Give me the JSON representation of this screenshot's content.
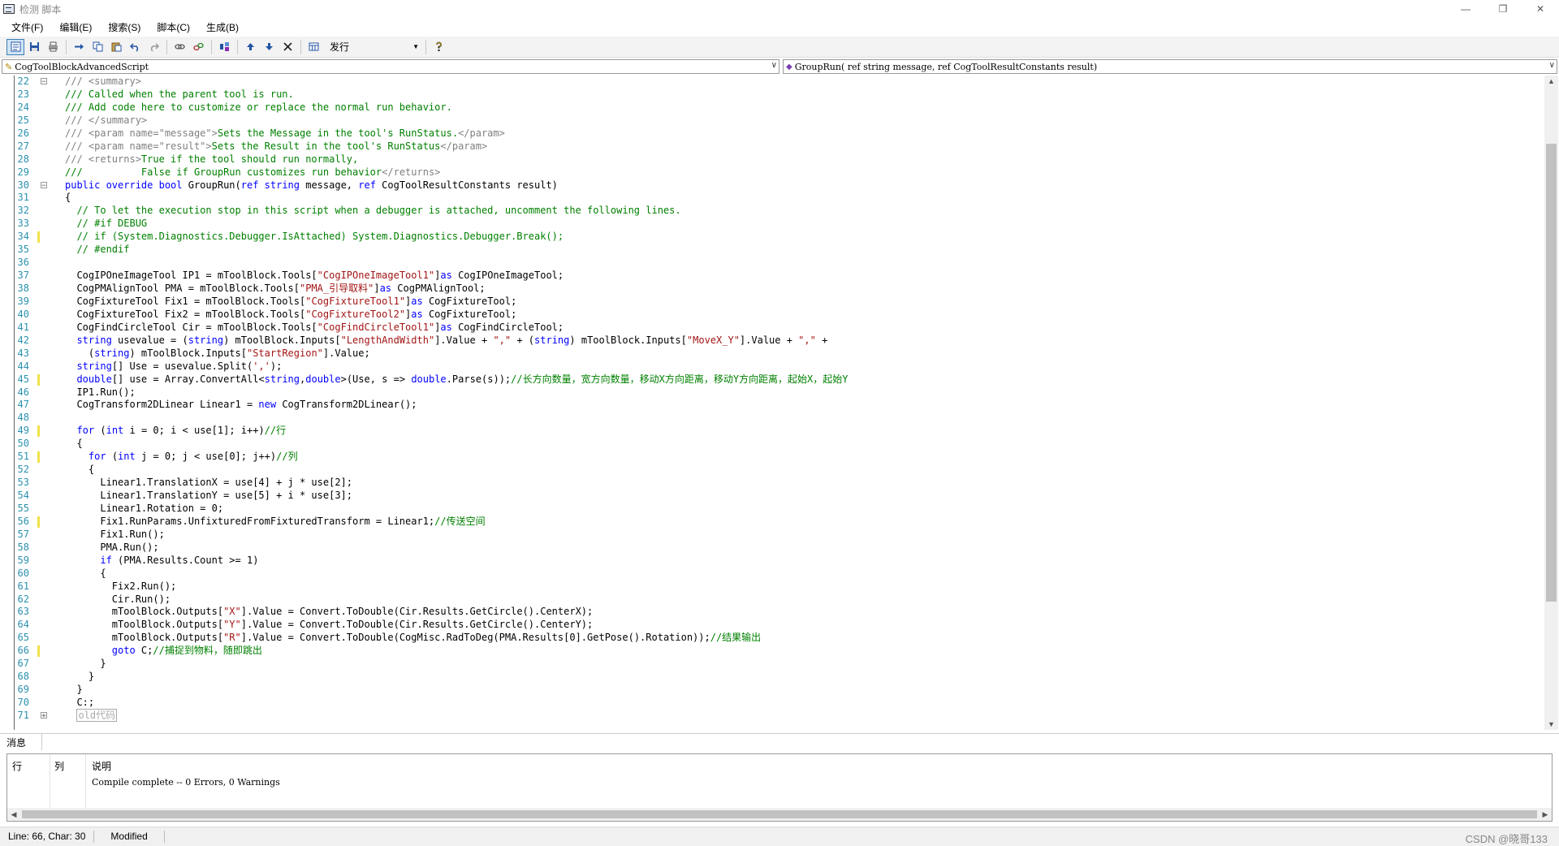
{
  "window": {
    "title": "检测 脚本",
    "minimize": "—",
    "restore": "❐",
    "close": "✕"
  },
  "menu": [
    "文件(F)",
    "编辑(E)",
    "搜索(S)",
    "脚本(C)",
    "生成(B)"
  ],
  "toolbar": {
    "build_select": "发行",
    "icons": [
      "script-view-icon",
      "save-icon",
      "print-icon",
      "indent-icon",
      "copy-icon",
      "paste-icon",
      "undo-icon",
      "redo-icon",
      "link-icon",
      "unlink-icon",
      "compile-icon",
      "up-arrow-icon",
      "down-arrow-icon",
      "delete-icon",
      "calculator-icon",
      "help-icon"
    ]
  },
  "combos": {
    "class": "CogToolBlockAdvancedScript",
    "method": "GroupRun( ref string message,  ref CogToolResultConstants result)"
  },
  "editor": {
    "lines": [
      {
        "n": "22",
        "fold": "minus",
        "mark": false,
        "html": "<span class=\"xm\">/// &lt;summary&gt;</span>"
      },
      {
        "n": "23",
        "mark": false,
        "html": "<span class=\"cm\">/// Called when the parent tool is run.</span>"
      },
      {
        "n": "24",
        "mark": false,
        "html": "<span class=\"cm\">/// Add code here to customize or replace the normal run behavior.</span>"
      },
      {
        "n": "25",
        "mark": false,
        "html": "<span class=\"xm\">/// &lt;/summary&gt;</span>"
      },
      {
        "n": "26",
        "mark": false,
        "html": "<span class=\"xm\">/// &lt;param name=\"message\"&gt;</span><span class=\"cm\">Sets the Message in the tool's RunStatus.</span><span class=\"xm\">&lt;/param&gt;</span>"
      },
      {
        "n": "27",
        "mark": false,
        "html": "<span class=\"xm\">/// &lt;param name=\"result\"&gt;</span><span class=\"cm\">Sets the Result in the tool's RunStatus</span><span class=\"xm\">&lt;/param&gt;</span>"
      },
      {
        "n": "28",
        "mark": false,
        "html": "<span class=\"xm\">/// &lt;returns&gt;</span><span class=\"cm\">True if the tool should run normally,</span>"
      },
      {
        "n": "29",
        "mark": false,
        "html": "<span class=\"cm\">///          False if GroupRun customizes run behavior</span><span class=\"xm\">&lt;/returns&gt;</span>"
      },
      {
        "n": "30",
        "fold": "minus",
        "mark": false,
        "html": "<span class=\"kw\">public override bool</span> GroupRun(<span class=\"kw\">ref string</span> message, <span class=\"kw\">ref</span> CogToolResultConstants result)"
      },
      {
        "n": "31",
        "mark": false,
        "html": "{"
      },
      {
        "n": "32",
        "mark": false,
        "html": "  <span class=\"cm\">// To let the execution stop in this script when a debugger is attached, uncomment the following lines.</span>"
      },
      {
        "n": "33",
        "mark": false,
        "html": "  <span class=\"cm\">// #if DEBUG</span>"
      },
      {
        "n": "34",
        "mark": true,
        "html": "  <span class=\"cm\">// if (System.Diagnostics.Debugger.IsAttached) System.Diagnostics.Debugger.Break();</span>"
      },
      {
        "n": "35",
        "mark": false,
        "html": "  <span class=\"cm\">// #endif</span>"
      },
      {
        "n": "36",
        "mark": false,
        "html": ""
      },
      {
        "n": "37",
        "mark": false,
        "html": "  CogIPOneImageTool IP1 = mToolBlock.Tools[<span class=\"str\">\"CogIPOneImageTool1\"</span>]<span class=\"kw\">as</span> CogIPOneImageTool;"
      },
      {
        "n": "38",
        "mark": false,
        "html": "  CogPMAlignTool PMA = mToolBlock.Tools[<span class=\"str\">\"PMA_引导取料\"</span>]<span class=\"kw\">as</span> CogPMAlignTool;"
      },
      {
        "n": "39",
        "mark": false,
        "html": "  CogFixtureTool Fix1 = mToolBlock.Tools[<span class=\"str\">\"CogFixtureTool1\"</span>]<span class=\"kw\">as</span> CogFixtureTool;"
      },
      {
        "n": "40",
        "mark": false,
        "html": "  CogFixtureTool Fix2 = mToolBlock.Tools[<span class=\"str\">\"CogFixtureTool2\"</span>]<span class=\"kw\">as</span> CogFixtureTool;"
      },
      {
        "n": "41",
        "mark": false,
        "html": "  CogFindCircleTool Cir = mToolBlock.Tools[<span class=\"str\">\"CogFindCircleTool1\"</span>]<span class=\"kw\">as</span> CogFindCircleTool;"
      },
      {
        "n": "42",
        "mark": false,
        "html": "  <span class=\"kw\">string</span> usevalue = (<span class=\"kw\">string</span>) mToolBlock.Inputs[<span class=\"str\">\"LengthAndWidth\"</span>].Value + <span class=\"str\">\",\"</span> + (<span class=\"kw\">string</span>) mToolBlock.Inputs[<span class=\"str\">\"MoveX_Y\"</span>].Value + <span class=\"str\">\",\"</span> +"
      },
      {
        "n": "43",
        "mark": false,
        "html": "    (<span class=\"kw\">string</span>) mToolBlock.Inputs[<span class=\"str\">\"StartRegion\"</span>].Value;"
      },
      {
        "n": "44",
        "mark": false,
        "html": "  <span class=\"kw\">string</span>[] Use = usevalue.Split(<span class=\"str\">','</span>);"
      },
      {
        "n": "45",
        "mark": true,
        "html": "  <span class=\"kw\">double</span>[] use = Array.ConvertAll&lt;<span class=\"kw\">string</span>,<span class=\"kw\">double</span>&gt;(Use, s =&gt; <span class=\"kw\">double</span>.Parse(s));<span class=\"cm\">//长方向数量，宽方向数量，移动X方向距离，移动Y方向距离，起始X，起始Y</span>"
      },
      {
        "n": "46",
        "mark": false,
        "html": "  IP1.Run();"
      },
      {
        "n": "47",
        "mark": false,
        "html": "  CogTransform2DLinear Linear1 = <span class=\"kw\">new</span> CogTransform2DLinear();"
      },
      {
        "n": "48",
        "mark": false,
        "html": ""
      },
      {
        "n": "49",
        "mark": true,
        "html": "  <span class=\"kw\">for</span> (<span class=\"kw\">int</span> i = 0; i &lt; use[1]; i++)<span class=\"cm\">//行</span>"
      },
      {
        "n": "50",
        "mark": false,
        "html": "  {"
      },
      {
        "n": "51",
        "mark": true,
        "html": "    <span class=\"kw\">for</span> (<span class=\"kw\">int</span> j = 0; j &lt; use[0]; j++)<span class=\"cm\">//列</span>"
      },
      {
        "n": "52",
        "mark": false,
        "html": "    {"
      },
      {
        "n": "53",
        "mark": false,
        "html": "      Linear1.TranslationX = use[4] + j * use[2];"
      },
      {
        "n": "54",
        "mark": false,
        "html": "      Linear1.TranslationY = use[5] + i * use[3];"
      },
      {
        "n": "55",
        "mark": false,
        "html": "      Linear1.Rotation = 0;"
      },
      {
        "n": "56",
        "mark": true,
        "html": "      Fix1.RunParams.UnfixturedFromFixturedTransform = Linear1;<span class=\"cm\">//传送空间</span>"
      },
      {
        "n": "57",
        "mark": false,
        "html": "      Fix1.Run();"
      },
      {
        "n": "58",
        "mark": false,
        "html": "      PMA.Run();"
      },
      {
        "n": "59",
        "mark": false,
        "html": "      <span class=\"kw\">if</span> (PMA.Results.Count &gt;= 1)"
      },
      {
        "n": "60",
        "mark": false,
        "html": "      {"
      },
      {
        "n": "61",
        "mark": false,
        "html": "        Fix2.Run();"
      },
      {
        "n": "62",
        "mark": false,
        "html": "        Cir.Run();"
      },
      {
        "n": "63",
        "mark": false,
        "html": "        mToolBlock.Outputs[<span class=\"str\">\"X\"</span>].Value = Convert.ToDouble(Cir.Results.GetCircle().CenterX);"
      },
      {
        "n": "64",
        "mark": false,
        "html": "        mToolBlock.Outputs[<span class=\"str\">\"Y\"</span>].Value = Convert.ToDouble(Cir.Results.GetCircle().CenterY);"
      },
      {
        "n": "65",
        "mark": false,
        "html": "        mToolBlock.Outputs[<span class=\"str\">\"R\"</span>].Value = Convert.ToDouble(CogMisc.RadToDeg(PMA.Results[0].GetPose().Rotation));<span class=\"cm\">//结果输出</span>"
      },
      {
        "n": "66",
        "mark": true,
        "html": "        <span class=\"kw\">goto</span> C;<span class=\"cm\">//捕捉到物料，随即跳出</span>"
      },
      {
        "n": "67",
        "mark": false,
        "html": "      }"
      },
      {
        "n": "68",
        "mark": false,
        "html": "    }"
      },
      {
        "n": "69",
        "mark": false,
        "html": "  }"
      },
      {
        "n": "70",
        "mark": false,
        "html": "  C:;"
      },
      {
        "n": "71",
        "fold": "plus",
        "mark": false,
        "html": "  <span class=\"collapsed\">old代码</span>"
      }
    ]
  },
  "messages": {
    "tab": "消息",
    "col_line": "行",
    "col_col": "列",
    "col_desc": "说明",
    "row": "Compile complete -- 0 Errors, 0 Warnings"
  },
  "status": {
    "position": "Line: 66, Char: 30",
    "state": "Modified",
    "watermark": "CSDN @晓哥133"
  }
}
